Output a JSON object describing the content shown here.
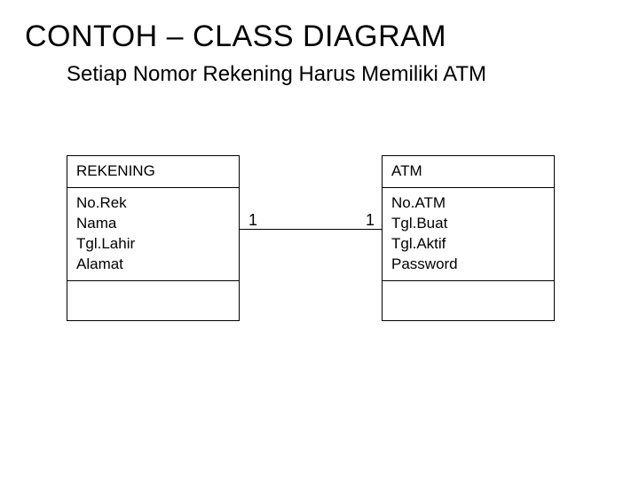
{
  "title": "CONTOH – CLASS DIAGRAM",
  "subtitle": "Setiap Nomor Rekening Harus Memiliki ATM",
  "classes": {
    "rekening": {
      "name": "REKENING",
      "attrs": [
        "No.Rek",
        "Nama",
        "Tgl.Lahir",
        "Alamat"
      ]
    },
    "atm": {
      "name": "ATM",
      "attrs": [
        "No.ATM",
        "Tgl.Buat",
        "Tgl.Aktif",
        "Password"
      ]
    }
  },
  "association": {
    "left_mult": "1",
    "right_mult": "1"
  }
}
